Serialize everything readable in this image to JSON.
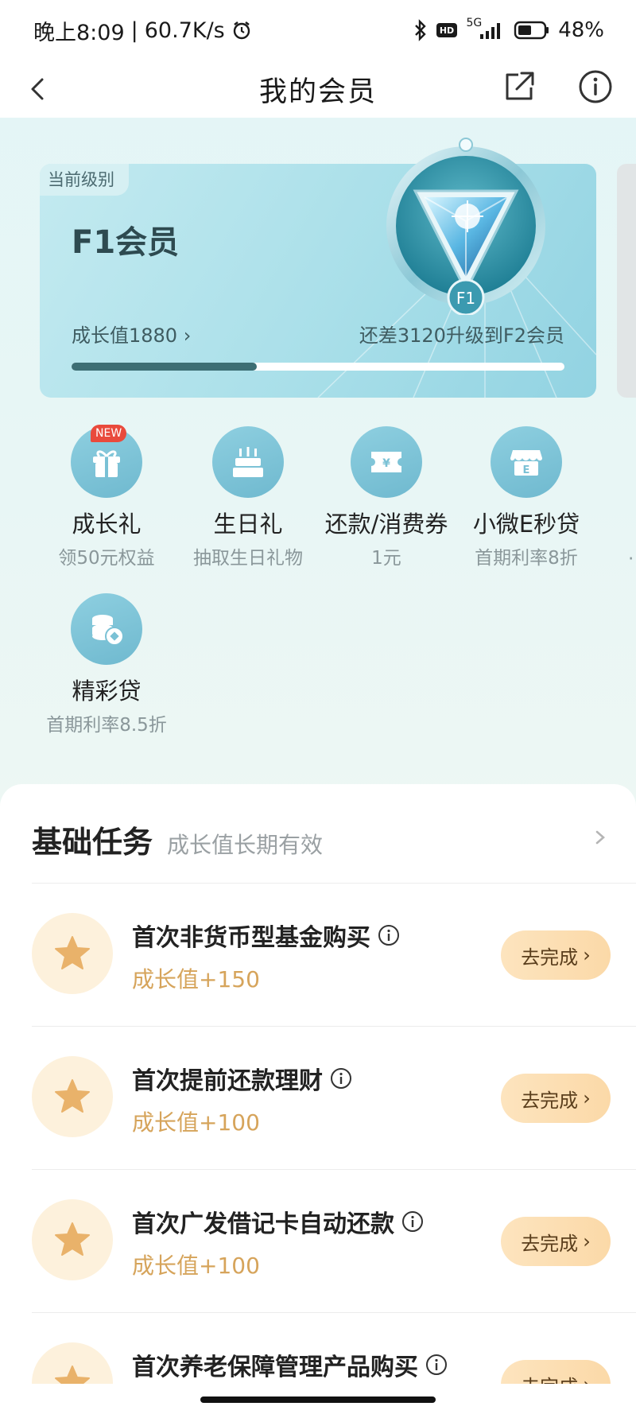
{
  "status_bar": {
    "time": "晚上8:09",
    "speed": "60.7K/s",
    "network": "5G",
    "battery": "48%"
  },
  "nav": {
    "title": "我的会员"
  },
  "level_card": {
    "tag": "当前级别",
    "level_name": "F1会员",
    "badge_label": "F1",
    "growth_value": "成长值1880",
    "upgrade_text": "还差3120升级到F2会员",
    "progress_fraction": 0.376
  },
  "benefits": [
    {
      "title": "成长礼",
      "sub": "领50元权益",
      "badge": "NEW",
      "icon": "gift-icon"
    },
    {
      "title": "生日礼",
      "sub": "抽取生日礼物",
      "icon": "cake-icon"
    },
    {
      "title": "还款/消费券",
      "sub": "1元",
      "icon": "coupon-icon"
    },
    {
      "title": "小微E秒贷",
      "sub": "首期利率8折",
      "icon": "shop-icon"
    },
    {
      "title": "精彩贷",
      "sub": "首期利率8.5折",
      "icon": "coins-icon"
    }
  ],
  "tasks": {
    "title": "基础任务",
    "subtitle": "成长值长期有效",
    "items": [
      {
        "name": "首次非货币型基金购买",
        "reward": "成长值+150",
        "button": "去完成"
      },
      {
        "name": "首次提前还款理财",
        "reward": "成长值+100",
        "button": "去完成"
      },
      {
        "name": "首次广发借记卡自动还款",
        "reward": "成长值+100",
        "button": "去完成"
      },
      {
        "name": "首次养老保障管理产品购买",
        "reward": "",
        "button": "去完成"
      }
    ]
  },
  "colors": {
    "accent_teal": "#3d6e74",
    "reward_gold": "#d6a45b",
    "button_bg": "#fde4be",
    "new_badge": "#e94a3c"
  }
}
